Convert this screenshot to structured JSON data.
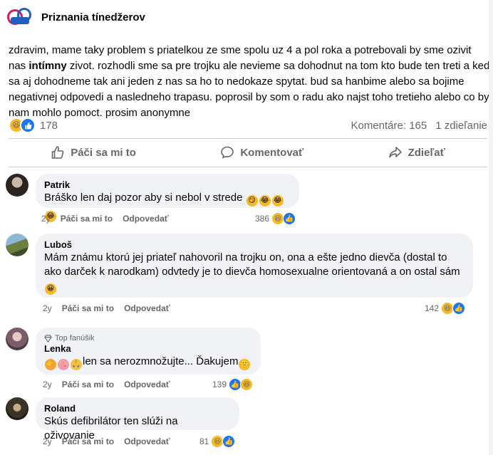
{
  "page": {
    "name": "Priznania tínedžerov"
  },
  "post": {
    "text_before": "zdravim, mame taky problem s priatelkou ze sme spolu uz 4 a pol roka a potrebovali by sme ozivit nas ",
    "text_bold": "intímny",
    "text_after": "  zivot. rozhodli sme sa pre trojku ale nevieme sa dohodnut na tom kto bude ten treti a ked sa aj dohodneme tak ani jeden z nas sa ho to nedokaze spytat. bud sa hanbime alebo sa bojime negativnej odpovedi a nasledneho trapasu. poprosil by som o radu ako najst toho tretieho alebo co by nam mohlo pomoct. prosim anonymne",
    "reaction_count": "178",
    "comments_label": "Komentáre: 165",
    "shares_label": "1 zdieľanie"
  },
  "actions": {
    "like": "Páči sa mi to",
    "comment": "Komentovať",
    "share": "Zdieľať"
  },
  "comment_meta": {
    "like": "Páči sa mi to",
    "reply": "Odpovedať"
  },
  "comments": [
    {
      "author": "Patrik",
      "text": "Bráško len daj pozor aby si nebol v strede",
      "time": "2y",
      "reactions": "386"
    },
    {
      "author": "Luboš",
      "text": "Mám známu ktorú jej priateľ nahovoril na trojku on, ona a ešte jedno dievča (dostal to ako darček k narodkam) odvtedy je to dievča homosexualne orientovaná a on ostal sám",
      "time": "2y",
      "reactions": "142"
    },
    {
      "author": "Lenka",
      "badge": "Top fanúšik",
      "text": "len sa nerozmnožujte... Ďakujem",
      "time": "2y",
      "reactions": "139"
    },
    {
      "author": "Roland",
      "text": "Skús defibrilátor ten slúži na oživovanie",
      "time": "2y",
      "reactions": "81"
    }
  ],
  "icons": [
    "page-logo",
    "haha-reaction-icon",
    "like-reaction-icon",
    "thumbs-up-icon",
    "speech-bubble-icon",
    "share-arrow-icon",
    "diamond-icon"
  ],
  "colors": {
    "accent": "#1877f2",
    "muted": "#65676b",
    "bubble": "#f0f2f5",
    "haha": "#f7b928"
  }
}
